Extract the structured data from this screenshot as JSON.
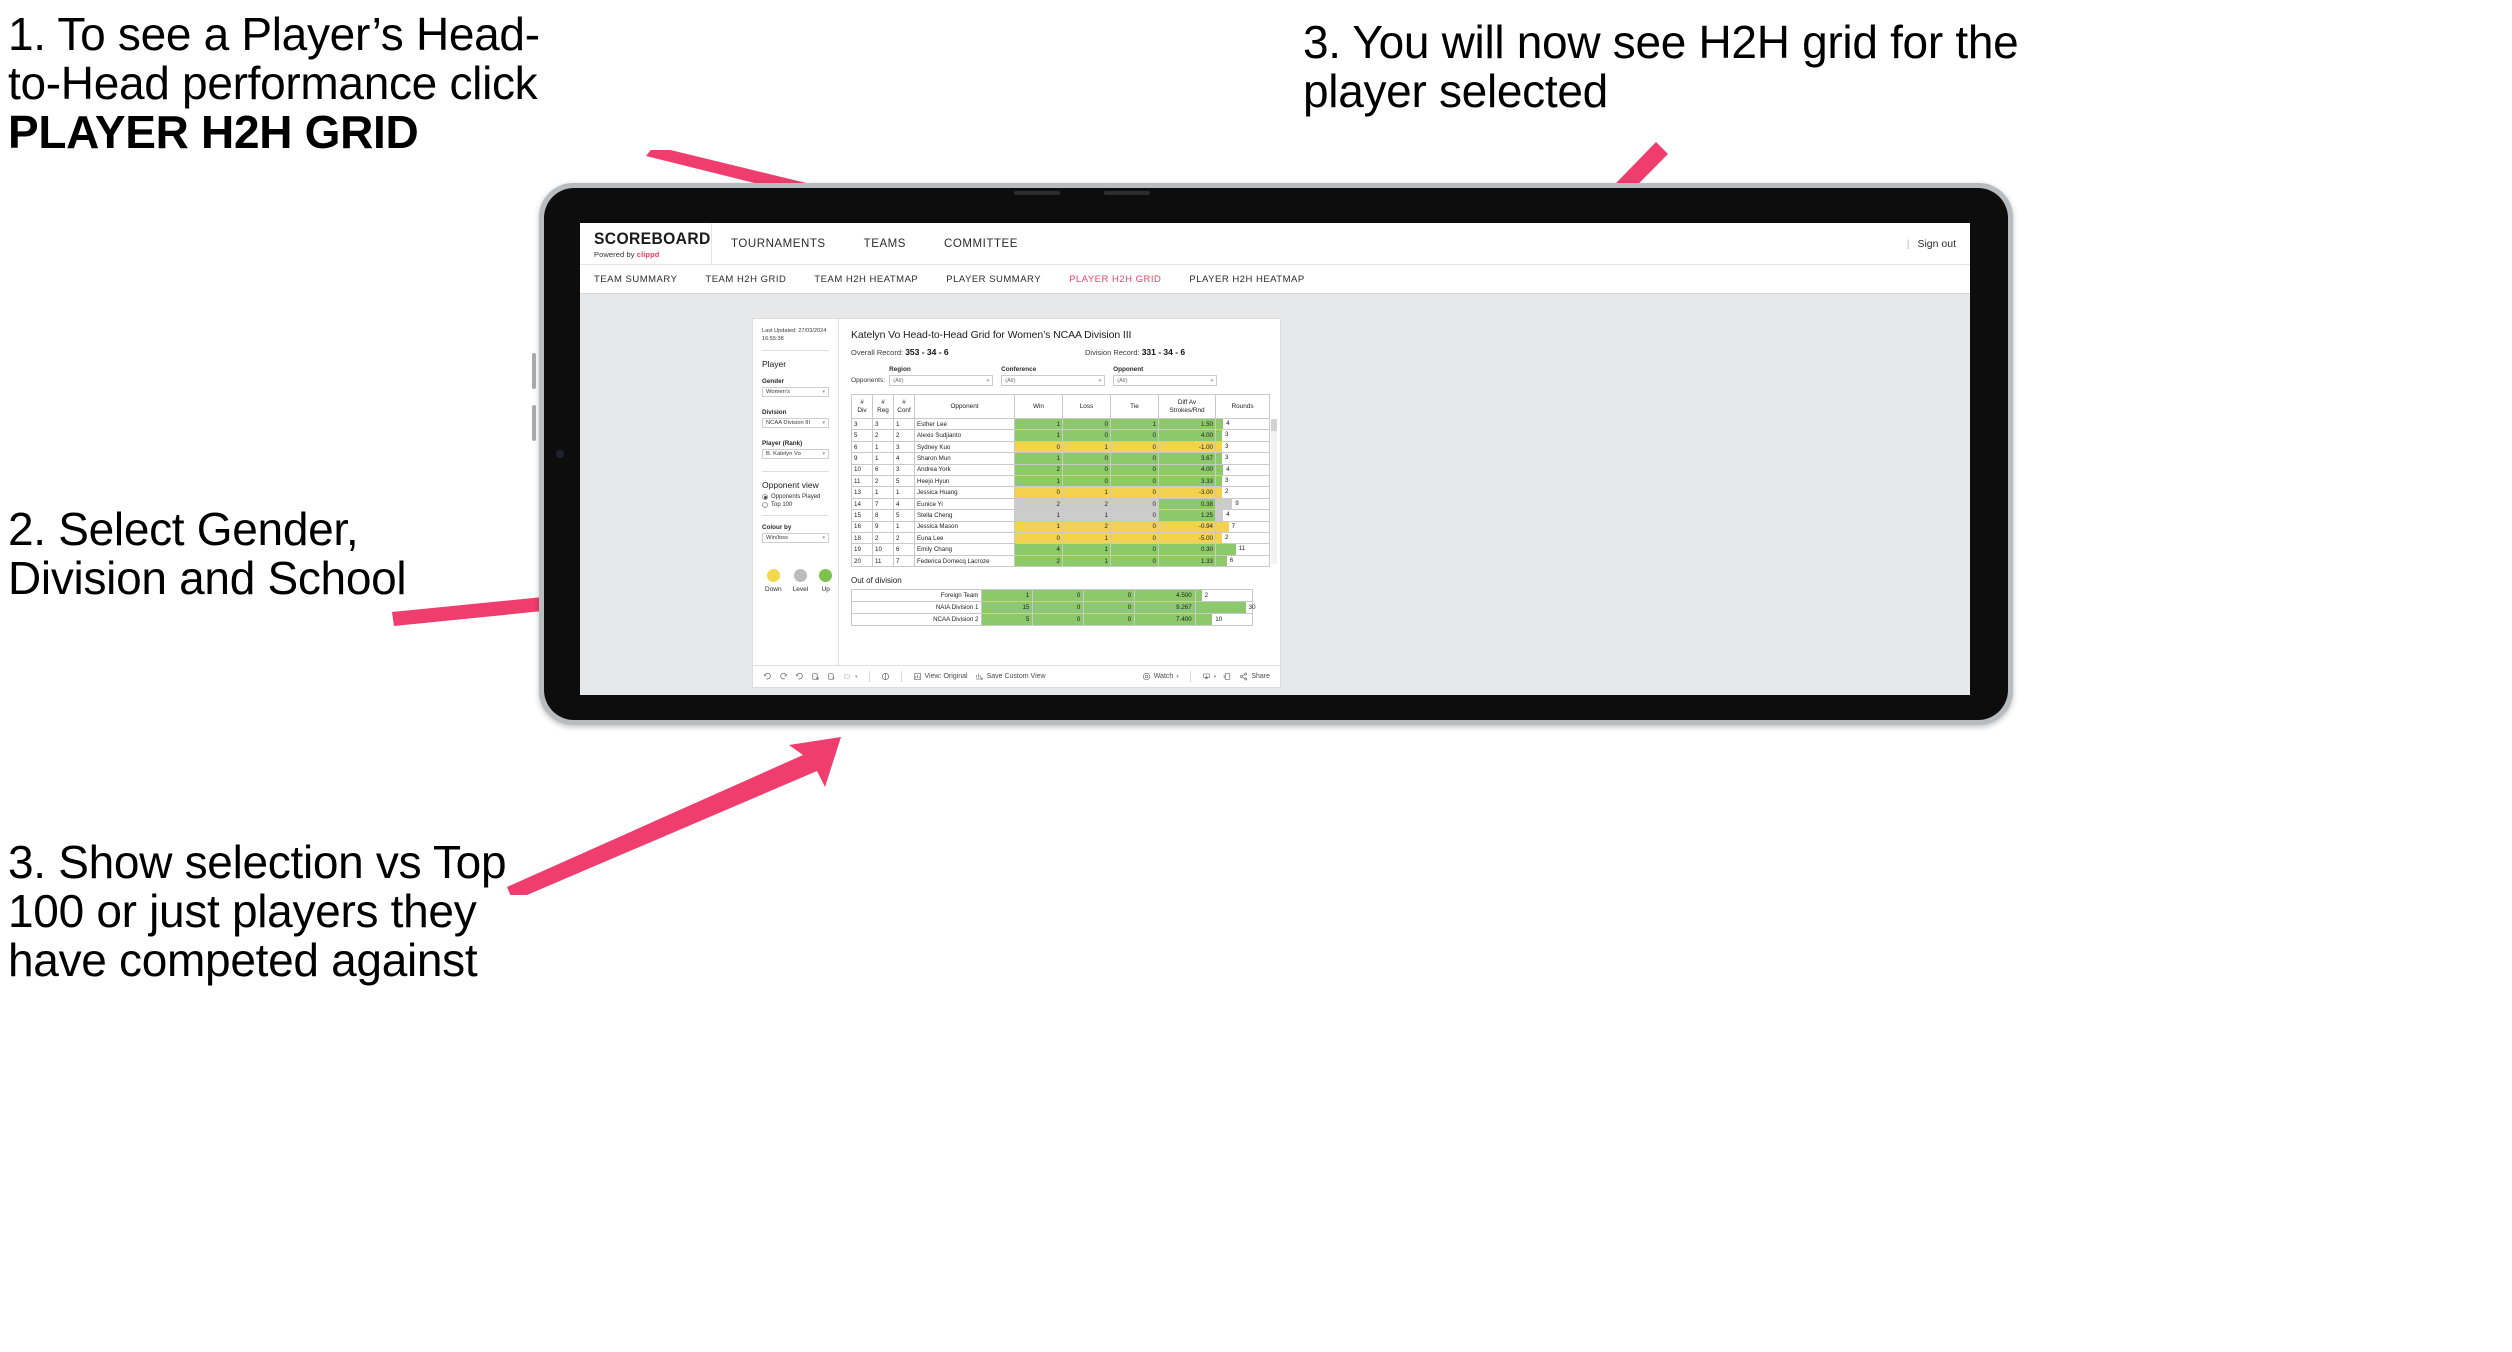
{
  "annotations": {
    "a1_line1": "1. To see a Player’s Head-",
    "a1_line2": "to-Head performance click",
    "a1_bold": "PLAYER H2H GRID",
    "a2": "2. Select Gender, Division and School",
    "a3": "3. Show selection vs Top 100 or just players they have competed against",
    "a4": "3. You will now see H2H grid for the player selected",
    "arrow_color": "#ef3d6e"
  },
  "app": {
    "brand_title": "SCOREBOARD",
    "brand_sub_prefix": "Powered by ",
    "brand_sub_name": "clippd",
    "brand_accent": "#ef4266",
    "top_nav": [
      "TOURNAMENTS",
      "TEAMS",
      "COMMITTEE"
    ],
    "top_right": {
      "divider": "|",
      "sign_out": "Sign out"
    },
    "sub_nav": [
      {
        "label": "TEAM SUMMARY",
        "active": false
      },
      {
        "label": "TEAM H2H GRID",
        "active": false
      },
      {
        "label": "TEAM H2H HEATMAP",
        "active": false
      },
      {
        "label": "PLAYER SUMMARY",
        "active": false
      },
      {
        "label": "PLAYER H2H GRID",
        "active": true
      },
      {
        "label": "PLAYER H2H HEATMAP",
        "active": false
      }
    ]
  },
  "rail": {
    "last_updated": "Last Updated: 27/03/2024 16:55:38",
    "section_player": "Player",
    "gender_label": "Gender",
    "gender_value": "Women's",
    "division_label": "Division",
    "division_value": "NCAA Division III",
    "player_label": "Player (Rank)",
    "player_value": "B. Katelyn Vo",
    "opponent_view_label": "Opponent view",
    "opponent_view_options": [
      {
        "label": "Opponents Played",
        "selected": true
      },
      {
        "label": "Top 100",
        "selected": false
      }
    ],
    "colour_by_label": "Colour by",
    "colour_by_value": "Win/loss",
    "legend": [
      {
        "label": "Down",
        "color": "#f2d84b"
      },
      {
        "label": "Level",
        "color": "#bcbcbc"
      },
      {
        "label": "Up",
        "color": "#7cc24b"
      }
    ]
  },
  "viz": {
    "title": "Katelyn Vo Head-to-Head Grid for Women’s NCAA Division III",
    "overall_record_label": "Overall Record: ",
    "overall_record_value": "353 - 34 - 6",
    "division_record_label": "Division Record: ",
    "division_record_value": "331 - 34 - 6",
    "opponents_label": "Opponents:",
    "filters": [
      {
        "label": "Region",
        "value": "(All)"
      },
      {
        "label": "Conference",
        "value": "(All)"
      },
      {
        "label": "Opponent",
        "value": "(All)"
      }
    ],
    "columns": [
      {
        "top": "#",
        "bottom": "Div"
      },
      {
        "top": "#",
        "bottom": "Reg"
      },
      {
        "top": "#",
        "bottom": "Conf"
      },
      {
        "top": "Opponent",
        "bottom": ""
      },
      {
        "top": "Win",
        "bottom": ""
      },
      {
        "top": "Loss",
        "bottom": ""
      },
      {
        "top": "Tie",
        "bottom": ""
      },
      {
        "top": "Diff Av",
        "bottom": "Strokes/Rnd"
      },
      {
        "top": "Rounds",
        "bottom": ""
      }
    ],
    "rows": [
      {
        "div": "3",
        "reg": "3",
        "conf": "1",
        "opponent": "Esther Lee",
        "win": "1",
        "loss": "0",
        "tie": "1",
        "diff": "1.50",
        "rounds": "4",
        "color": "#8cc96a"
      },
      {
        "div": "5",
        "reg": "2",
        "conf": "2",
        "opponent": "Alexis Sudjianto",
        "win": "1",
        "loss": "0",
        "tie": "0",
        "diff": "4.00",
        "rounds": "3",
        "color": "#8cc96a"
      },
      {
        "div": "6",
        "reg": "1",
        "conf": "3",
        "opponent": "Sydney Kuo",
        "win": "0",
        "loss": "1",
        "tie": "0",
        "diff": "-1.00",
        "rounds": "3",
        "color": "#f3d34e"
      },
      {
        "div": "9",
        "reg": "1",
        "conf": "4",
        "opponent": "Sharon Mun",
        "win": "1",
        "loss": "0",
        "tie": "0",
        "diff": "3.67",
        "rounds": "3",
        "color": "#8cc96a"
      },
      {
        "div": "10",
        "reg": "6",
        "conf": "3",
        "opponent": "Andrea York",
        "win": "2",
        "loss": "0",
        "tie": "0",
        "diff": "4.00",
        "rounds": "4",
        "color": "#8cc96a"
      },
      {
        "div": "11",
        "reg": "2",
        "conf": "5",
        "opponent": "Heejo Hyun",
        "win": "1",
        "loss": "0",
        "tie": "0",
        "diff": "3.33",
        "rounds": "3",
        "color": "#8cc96a"
      },
      {
        "div": "13",
        "reg": "1",
        "conf": "1",
        "opponent": "Jessica Huang",
        "win": "0",
        "loss": "1",
        "tie": "0",
        "diff": "-3.00",
        "rounds": "2",
        "color": "#f3d34e"
      },
      {
        "div": "14",
        "reg": "7",
        "conf": "4",
        "opponent": "Eunice Yi",
        "win": "2",
        "loss": "2",
        "tie": "0",
        "diff": "0.38",
        "rounds": "9",
        "color": "#cccccc",
        "diff_color": "#8cc96a"
      },
      {
        "div": "15",
        "reg": "8",
        "conf": "5",
        "opponent": "Stella Cheng",
        "win": "1",
        "loss": "1",
        "tie": "0",
        "diff": "1.25",
        "rounds": "4",
        "color": "#cccccc",
        "diff_color": "#8cc96a"
      },
      {
        "div": "16",
        "reg": "9",
        "conf": "1",
        "opponent": "Jessica Mason",
        "win": "1",
        "loss": "2",
        "tie": "0",
        "diff": "-0.94",
        "rounds": "7",
        "color": "#f3d34e"
      },
      {
        "div": "18",
        "reg": "2",
        "conf": "2",
        "opponent": "Euna Lee",
        "win": "0",
        "loss": "1",
        "tie": "0",
        "diff": "-5.00",
        "rounds": "2",
        "color": "#f3d34e"
      },
      {
        "div": "19",
        "reg": "10",
        "conf": "6",
        "opponent": "Emily Chang",
        "win": "4",
        "loss": "1",
        "tie": "0",
        "diff": "0.30",
        "rounds": "11",
        "color": "#8cc96a"
      },
      {
        "div": "20",
        "reg": "11",
        "conf": "7",
        "opponent": "Federica Domecq Lacroze",
        "win": "2",
        "loss": "1",
        "tie": "0",
        "diff": "1.33",
        "rounds": "6",
        "color": "#8cc96a"
      }
    ],
    "out_of_division_title": "Out of division",
    "out_of_division": [
      {
        "name": "Foreign Team",
        "win": "1",
        "loss": "0",
        "tie": "0",
        "diff": "4.500",
        "rounds": "2",
        "color": "#8cc96a"
      },
      {
        "name": "NAIA Division 1",
        "win": "15",
        "loss": "0",
        "tie": "0",
        "diff": "9.267",
        "rounds": "30",
        "color": "#8cc96a"
      },
      {
        "name": "NCAA Division 2",
        "win": "5",
        "loss": "0",
        "tie": "0",
        "diff": "7.400",
        "rounds": "10",
        "color": "#8cc96a"
      }
    ]
  },
  "toolbar": {
    "view_original": "View: Original",
    "save_custom_view": "Save Custom View",
    "watch": "Watch",
    "share": "Share",
    "caret": "▾"
  },
  "chart_data": {
    "type": "table",
    "title": "Katelyn Vo Head-to-Head Grid for Women’s NCAA Division III",
    "columns": [
      "# Div",
      "# Reg",
      "# Conf",
      "Opponent",
      "Win",
      "Loss",
      "Tie",
      "Diff Av Strokes/Rnd",
      "Rounds"
    ],
    "rows": [
      [
        3,
        3,
        1,
        "Esther Lee",
        1,
        0,
        1,
        1.5,
        4
      ],
      [
        5,
        2,
        2,
        "Alexis Sudjianto",
        1,
        0,
        0,
        4.0,
        3
      ],
      [
        6,
        1,
        3,
        "Sydney Kuo",
        0,
        1,
        0,
        -1.0,
        3
      ],
      [
        9,
        1,
        4,
        "Sharon Mun",
        1,
        0,
        0,
        3.67,
        3
      ],
      [
        10,
        6,
        3,
        "Andrea York",
        2,
        0,
        0,
        4.0,
        4
      ],
      [
        11,
        2,
        5,
        "Heejo Hyun",
        1,
        0,
        0,
        3.33,
        3
      ],
      [
        13,
        1,
        1,
        "Jessica Huang",
        0,
        1,
        0,
        -3.0,
        2
      ],
      [
        14,
        7,
        4,
        "Eunice Yi",
        2,
        2,
        0,
        0.38,
        9
      ],
      [
        15,
        8,
        5,
        "Stella Cheng",
        1,
        1,
        0,
        1.25,
        4
      ],
      [
        16,
        9,
        1,
        "Jessica Mason",
        1,
        2,
        0,
        -0.94,
        7
      ],
      [
        18,
        2,
        2,
        "Euna Lee",
        0,
        1,
        0,
        -5.0,
        2
      ],
      [
        19,
        10,
        6,
        "Emily Chang",
        4,
        1,
        0,
        0.3,
        11
      ],
      [
        20,
        11,
        7,
        "Federica Domecq Lacroze",
        2,
        1,
        0,
        1.33,
        6
      ]
    ],
    "out_of_division_rows": [
      [
        "Foreign Team",
        1,
        0,
        0,
        4.5,
        2
      ],
      [
        "NAIA Division 1",
        15,
        0,
        0,
        9.267,
        30
      ],
      [
        "NCAA Division 2",
        5,
        0,
        0,
        7.4,
        10
      ]
    ],
    "rounds_max": 30,
    "colour_by": "Win/loss",
    "legend": [
      "Down",
      "Level",
      "Up"
    ]
  }
}
